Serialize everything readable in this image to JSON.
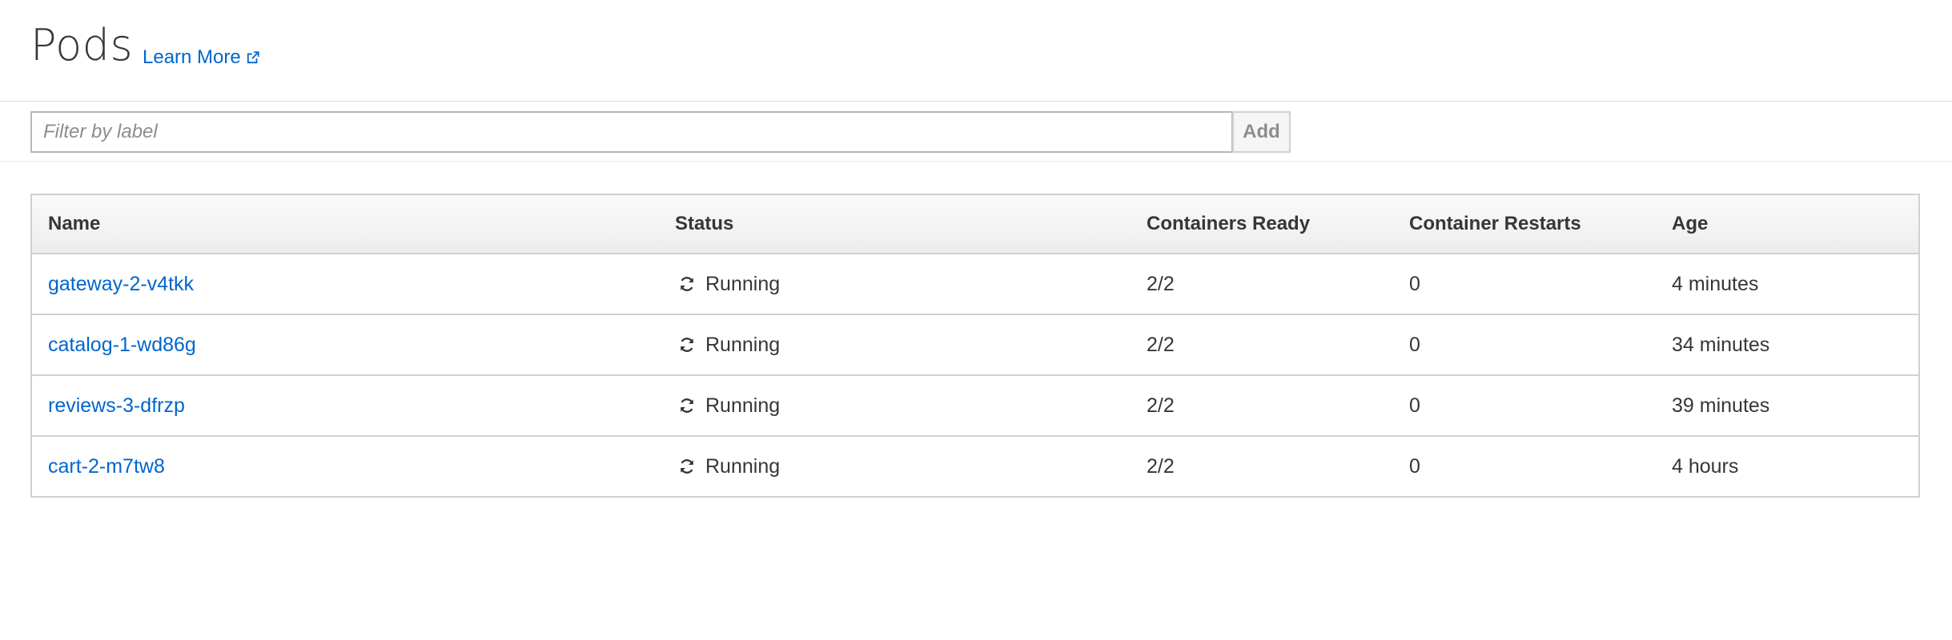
{
  "header": {
    "title": "Pods",
    "learn_more": "Learn More",
    "learn_more_icon": "external-link-icon"
  },
  "filter": {
    "placeholder": "Filter by label",
    "value": "",
    "add_label": "Add"
  },
  "table": {
    "columns": [
      "Name",
      "Status",
      "Containers Ready",
      "Container Restarts",
      "Age"
    ],
    "status_icon": "refresh-icon",
    "rows": [
      {
        "name": "gateway-2-v4tkk",
        "status": "Running",
        "ready": "2/2",
        "restarts": "0",
        "age": "4 minutes"
      },
      {
        "name": "catalog-1-wd86g",
        "status": "Running",
        "ready": "2/2",
        "restarts": "0",
        "age": "34 minutes"
      },
      {
        "name": "reviews-3-dfrzp",
        "status": "Running",
        "ready": "2/2",
        "restarts": "0",
        "age": "39 minutes"
      },
      {
        "name": "cart-2-m7tw8",
        "status": "Running",
        "ready": "2/2",
        "restarts": "0",
        "age": "4 hours"
      }
    ]
  },
  "colors": {
    "link": "#0066cc",
    "text": "#363636",
    "border": "#d1d1d1"
  }
}
